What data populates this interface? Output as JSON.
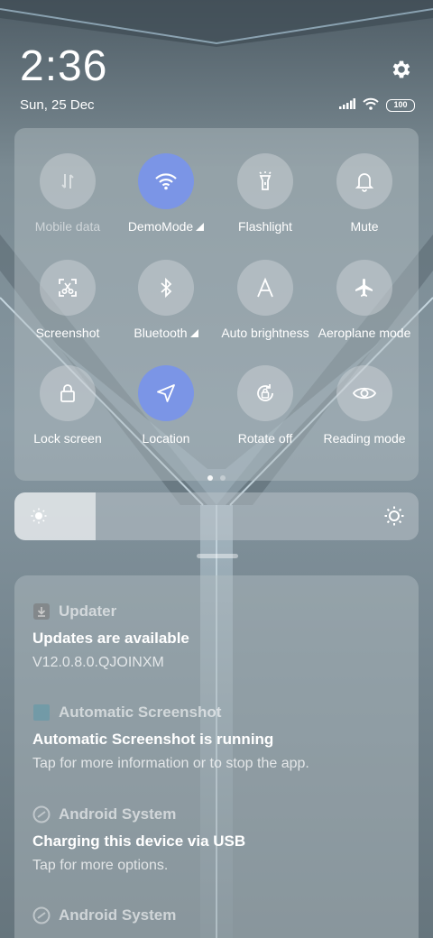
{
  "status": {
    "time": "2:36",
    "date": "Sun, 25 Dec",
    "battery": "100",
    "icons": [
      "signal-icon",
      "wifi-icon",
      "battery-icon",
      "gear-icon"
    ]
  },
  "quick_settings": {
    "tiles": [
      {
        "label": "Mobile data",
        "icon": "mobile-data-icon",
        "active": false,
        "dimmed": true
      },
      {
        "label": "DemoMode",
        "icon": "wifi-icon",
        "active": true,
        "expandable": true
      },
      {
        "label": "Flashlight",
        "icon": "flashlight-icon",
        "active": false
      },
      {
        "label": "Mute",
        "icon": "bell-icon",
        "active": false
      },
      {
        "label": "Screenshot",
        "icon": "screenshot-icon",
        "active": false
      },
      {
        "label": "Bluetooth",
        "icon": "bluetooth-icon",
        "active": false,
        "expandable": true
      },
      {
        "label": "Auto brightness",
        "icon": "auto-brightness-icon",
        "active": false
      },
      {
        "label": "Aeroplane mode",
        "icon": "airplane-icon",
        "active": false
      },
      {
        "label": "Lock screen",
        "icon": "lock-icon",
        "active": false
      },
      {
        "label": "Location",
        "icon": "location-icon",
        "active": true
      },
      {
        "label": "Rotate off",
        "icon": "rotate-lock-icon",
        "active": false
      },
      {
        "label": "Reading mode",
        "icon": "eye-icon",
        "active": false
      }
    ],
    "page": 1,
    "pages": 2,
    "accent": "#7b95e6"
  },
  "brightness": {
    "level": 0.2
  },
  "notifications": [
    {
      "app": "Updater",
      "app_icon": "updater-icon",
      "title": "Updates are available",
      "body": "V12.0.8.0.QJOINXM"
    },
    {
      "app": "Automatic Screenshot",
      "app_icon": "automatic-screenshot-icon",
      "title": "Automatic Screenshot is running",
      "body": "Tap for more information or to stop the app."
    },
    {
      "app": "Android System",
      "app_icon": "android-system-icon",
      "title": "Charging this device via USB",
      "body": "Tap for more options."
    },
    {
      "app": "Android System",
      "app_icon": "android-system-icon",
      "title": "",
      "body": ""
    }
  ]
}
